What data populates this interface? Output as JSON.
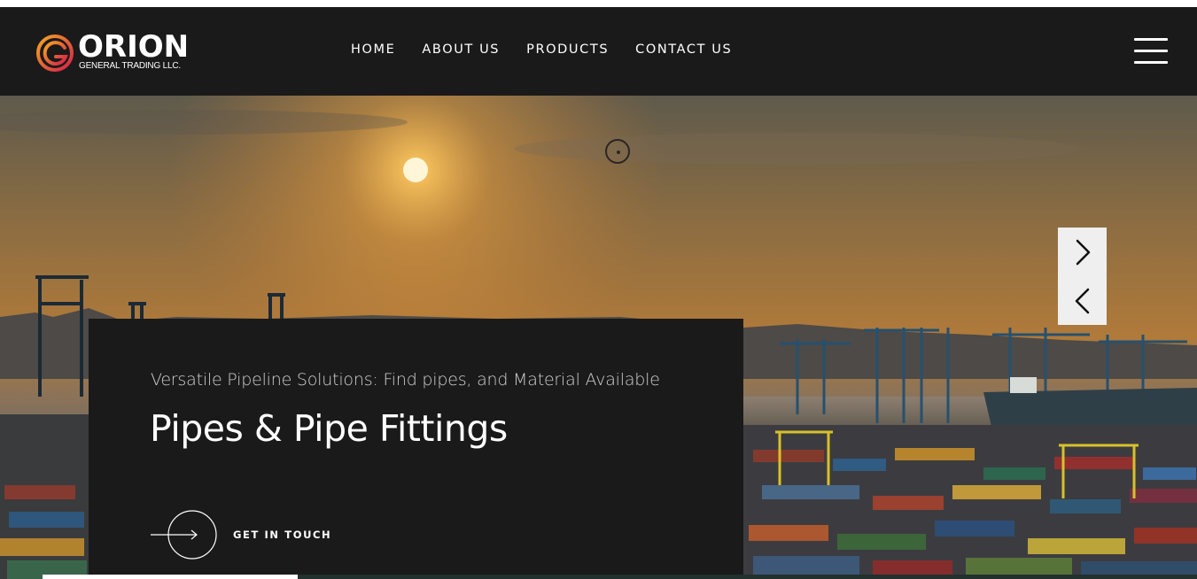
{
  "brand": {
    "name": "ORION",
    "tagline": "GENERAL TRADING LLC.",
    "logo_mark_icon": "orion-g-ring-logo",
    "colors": {
      "gradient_start": "#f5a623",
      "gradient_end": "#d6204b"
    }
  },
  "nav": {
    "items": [
      {
        "label": "HOME"
      },
      {
        "label": "ABOUT US"
      },
      {
        "label": "PRODUCTS"
      },
      {
        "label": "CONTACT US"
      }
    ],
    "menu_icon": "hamburger-icon"
  },
  "hero": {
    "subtitle": "Versatile Pipeline Solutions: Find pipes, and Material Available",
    "title": "Pipes & Pipe Fittings",
    "cta_label": "GET IN TOUCH",
    "cta_icon": "arrow-right-icon",
    "next_icon": "chevron-right-icon",
    "prev_icon": "chevron-left-icon"
  },
  "colors": {
    "header_bg": "#1b1a1a",
    "caption_bg": "#1b1a1a",
    "sky_top": "#6b5d48",
    "sky_glow": "#d9902f"
  }
}
